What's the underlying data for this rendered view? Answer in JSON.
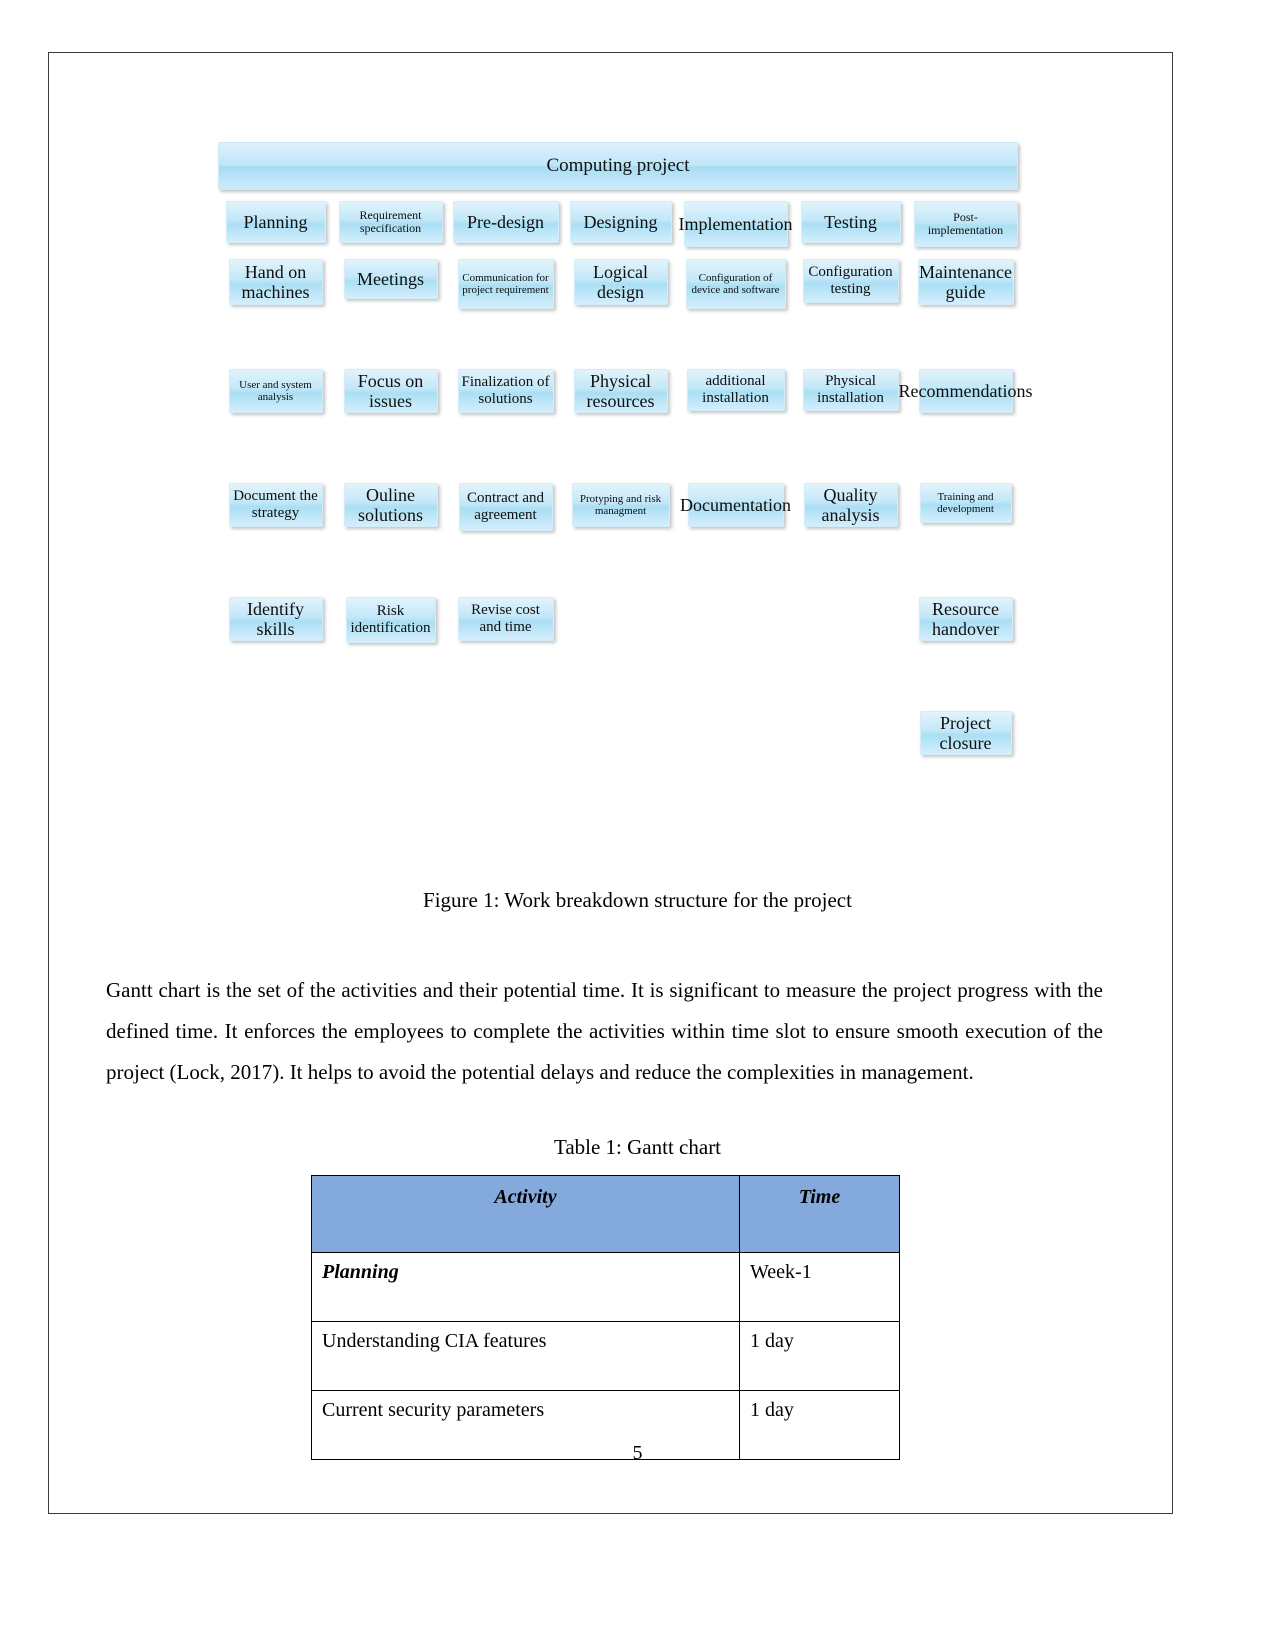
{
  "document": {
    "page_number": "5",
    "figure_caption": "Figure 1: Work breakdown structure for the project",
    "table_caption": "Table 1: Gantt chart",
    "paragraph": "Gantt chart is the set of the activities and their potential time. It is significant to measure the project progress with the defined time. It enforces the employees to complete the activities within time slot to ensure smooth execution of the project (Lock, 2017). It helps to avoid the potential delays and reduce the complexities in management."
  },
  "wbs": {
    "root": "Computing project",
    "rows": [
      [
        "Planning",
        "Requirement specification",
        "Pre-design",
        "Designing",
        "Implementation",
        "Testing",
        "Post-implementation"
      ],
      [
        "Hand on machines",
        "Meetings",
        "Communication for project requirement",
        "Logical design",
        "Configuration of device and software",
        "Configuration testing",
        "Maintenance guide"
      ],
      [
        "User and system analysis",
        "Focus on issues",
        "Finalization of solutions",
        "Physical resources",
        "additional installation",
        "Physical installation",
        "Recommendations"
      ],
      [
        "Document the strategy",
        "Ouline solutions",
        "Contract and agreement",
        "Protyping and risk managment",
        "Documentation",
        "Quality analysis",
        "Training and development"
      ],
      [
        "Identify skills",
        "Risk identification",
        "Revise cost and time",
        "",
        "",
        "",
        "Resource handover"
      ],
      [
        "",
        "",
        "",
        "",
        "",
        "",
        "Project closure"
      ]
    ]
  },
  "gantt_table": {
    "headers": [
      "Activity",
      "Time"
    ],
    "rows": [
      {
        "activity": "Planning",
        "time": "Week-1",
        "is_header_row": true
      },
      {
        "activity": "Understanding CIA features",
        "time": "1 day",
        "is_header_row": false
      },
      {
        "activity": "Current security parameters",
        "time": "1 day",
        "is_header_row": false
      }
    ]
  },
  "colors": {
    "box_fill": "#bfe6f8",
    "table_header_fill": "#84a9dd",
    "text": "#000000"
  }
}
